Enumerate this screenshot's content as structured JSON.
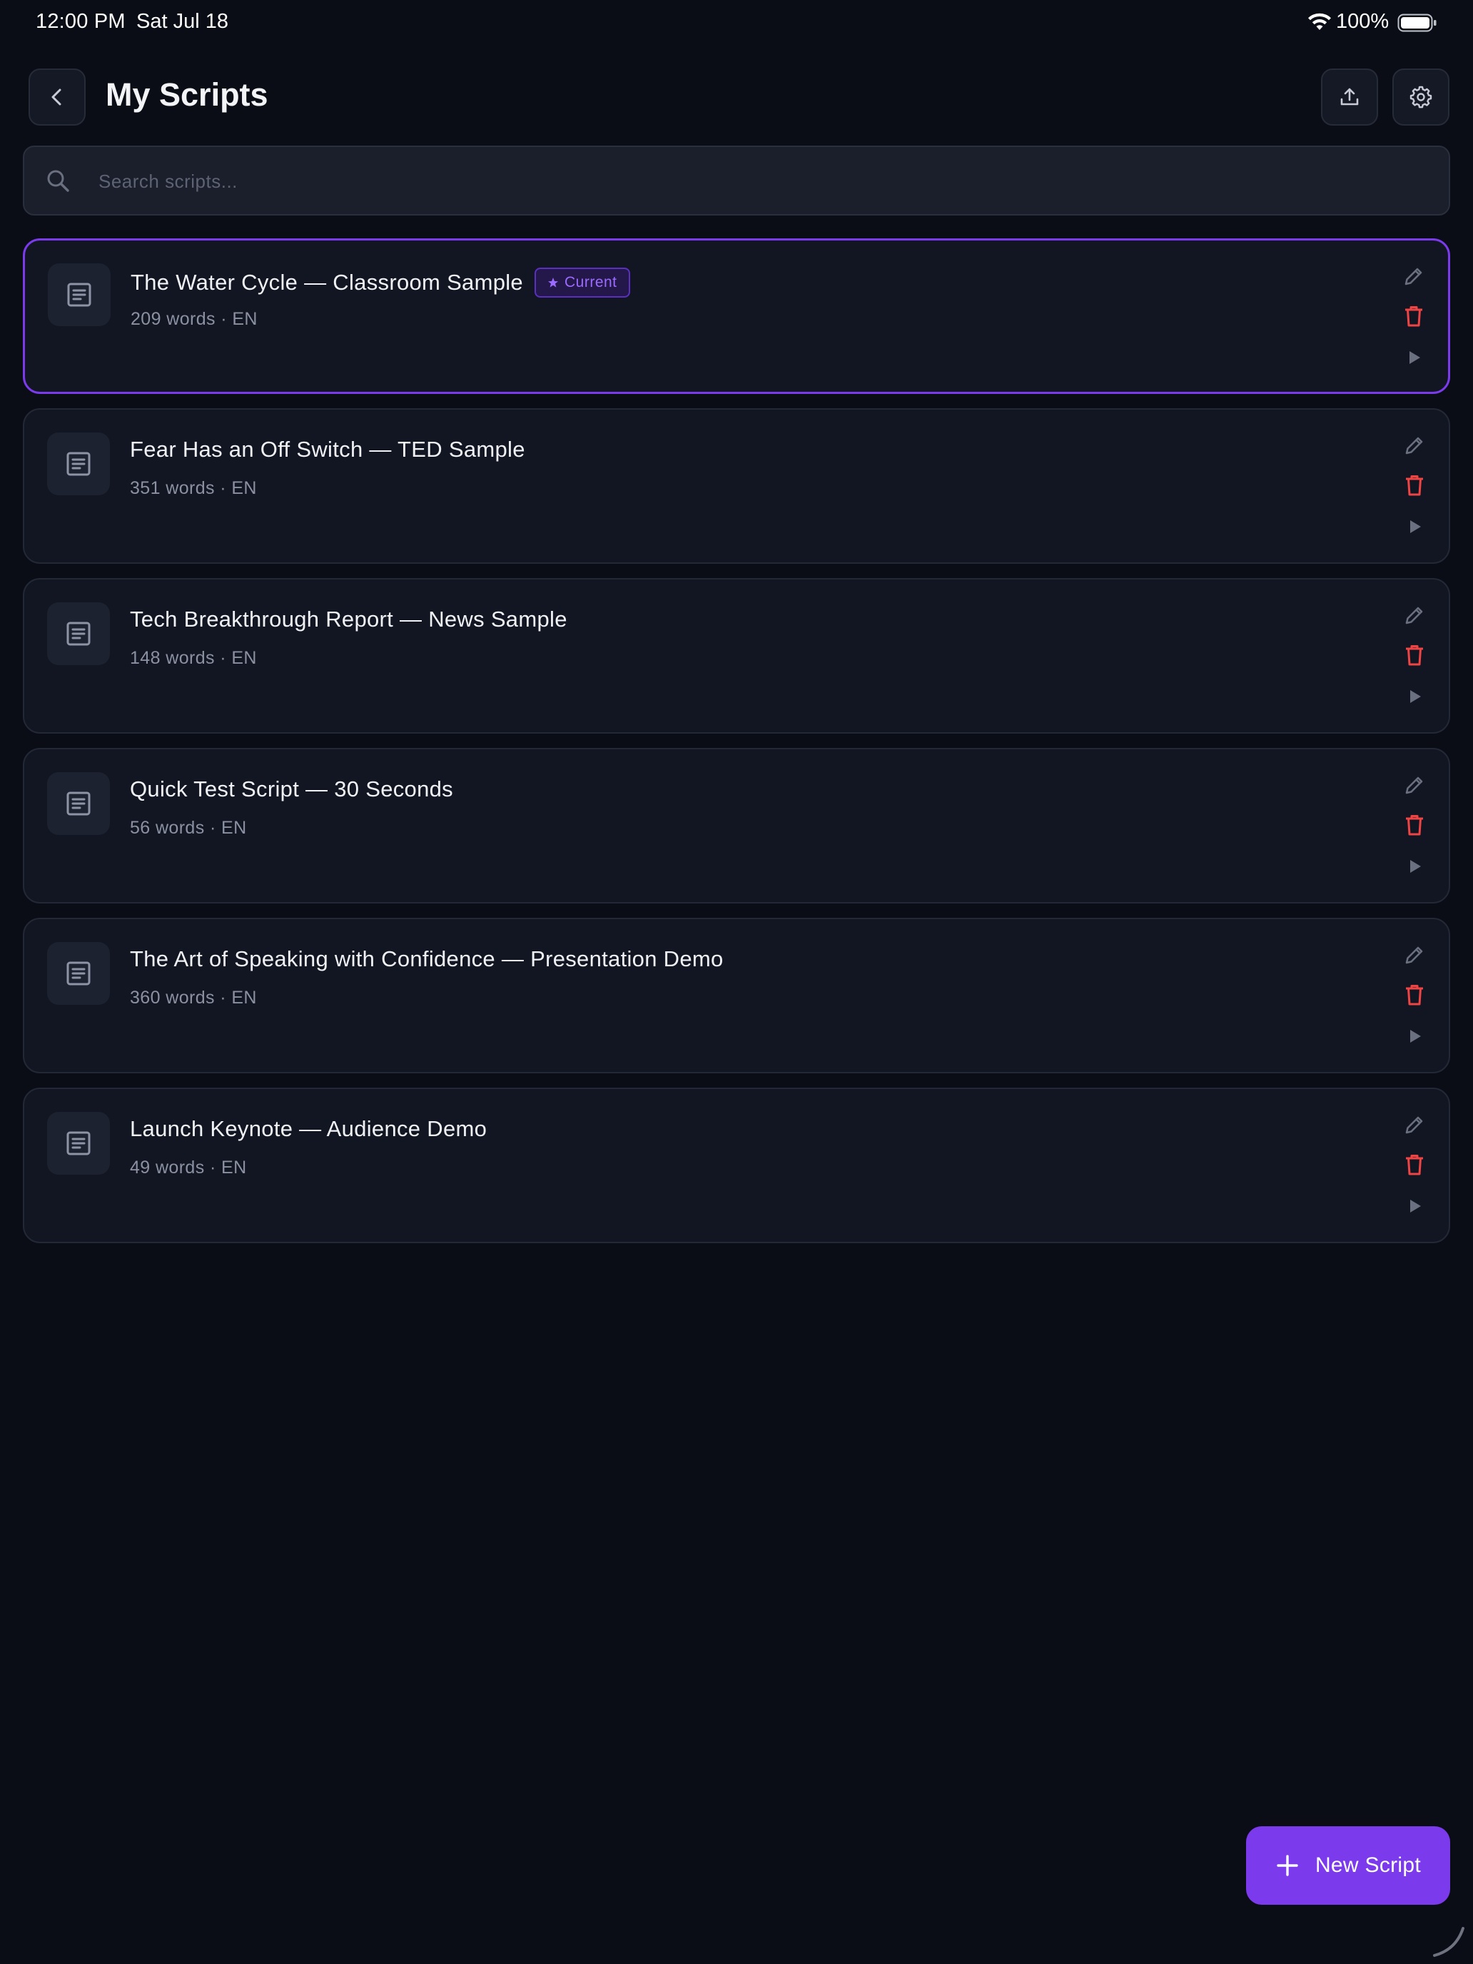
{
  "status_bar": {
    "time": "12:00 PM",
    "date": "Sat Jul 18",
    "battery": "100%"
  },
  "header": {
    "title": "My Scripts",
    "back_icon": "chevron-left-icon",
    "export_icon": "share-upload-icon",
    "settings_icon": "gear-icon"
  },
  "search": {
    "placeholder": "Search scripts...",
    "value": "",
    "icon": "search-icon"
  },
  "badge": {
    "label": "Current",
    "icon": "star-icon"
  },
  "scripts": [
    {
      "title": "The Water Cycle — Classroom Sample",
      "meta": "209 words · EN",
      "current": true
    },
    {
      "title": "Fear Has an Off Switch — TED Sample",
      "meta": "351 words · EN",
      "current": false
    },
    {
      "title": "Tech Breakthrough Report — News Sample",
      "meta": "148 words · EN",
      "current": false
    },
    {
      "title": "Quick Test Script — 30 Seconds",
      "meta": "56 words · EN",
      "current": false
    },
    {
      "title": "The Art of Speaking with Confidence — Presentation Demo",
      "meta": "360 words · EN",
      "current": false
    },
    {
      "title": "Launch Keynote — Audience Demo",
      "meta": "49 words · EN",
      "current": false
    }
  ],
  "fab": {
    "label": "New Script",
    "icon": "plus-icon"
  },
  "colors": {
    "background": "#0a0d16",
    "card": "#121622",
    "accent": "#7c3aed",
    "delete": "#ef4444",
    "muted_icon": "#6b7080"
  }
}
